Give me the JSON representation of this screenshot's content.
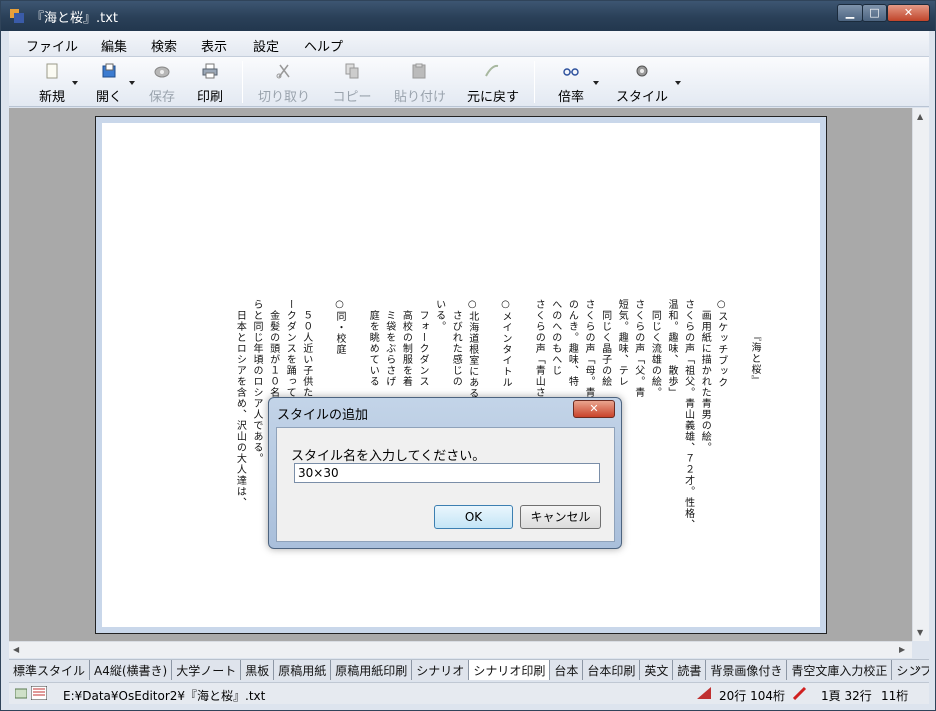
{
  "window": {
    "title": "『海と桜』.txt",
    "min": "▁",
    "max": "□",
    "close": "✕"
  },
  "menu": [
    "ファイル",
    "編集",
    "検索",
    "表示",
    "設定",
    "ヘルプ"
  ],
  "toolbar": {
    "new": "新規",
    "open": "開く",
    "save": "保存",
    "print": "印刷",
    "cut": "切り取り",
    "copy": "コピー",
    "paste": "貼り付け",
    "undo": "元に戻す",
    "zoom": "倍率",
    "style": "スタイル"
  },
  "document": {
    "columns": [
      "『海と桜』",
      "",
      "○スケッチブック",
      "　画用紙に描かれた青男の絵。",
      "さくらの声「祖父。青山義雄、７２才。性格、",
      "温和。趣味、散歩」",
      "　同じく流雄の絵。",
      "さくらの声「父。青",
      "短気。趣味、テレ",
      "　同じく晶子の絵",
      "さくらの声「母。青",
      "のんき。趣味、特",
      "へのへのもへじ",
      "さくらの声「青山さ",
      "",
      "○メインタイトル",
      "",
      "○北海道根室にある",
      "　さびれた感じの",
      "いる。",
      "　フォークダンス",
      "　高校の制服を着",
      "　ミ袋をぶらさげ",
      "　庭を眺めている",
      "",
      "○同・校庭",
      "",
      "　５０人近い子供たちが手をつなぎ、フォ",
      "ークダンスを踊っている。",
      "　金髪の頭が１０名ほど交じっている。彼",
      "らと同じ年頃のロシア人である。",
      "　日本とロシアを含め、沢山の大人達は、"
    ]
  },
  "tabs": [
    "標準スタイル",
    "A4縦(横書き)",
    "大学ノート",
    "黒板",
    "原稿用紙",
    "原稿用紙印刷",
    "シナリオ",
    "シナリオ印刷",
    "台本",
    "台本印刷",
    "英文",
    "読書",
    "背景画像付き",
    "青空文庫入力校正",
    "シンプル"
  ],
  "active_tab": "シナリオ印刷",
  "status": {
    "path": "E:¥Data¥OsEditor2¥『海と桜』.txt",
    "row_col": "20行 104桁",
    "page_line": "1頁 32行",
    "col": "11桁"
  },
  "dialog": {
    "title": "スタイルの追加",
    "close": "✕",
    "prompt": "スタイル名を入力してください。",
    "input_value": "30×30",
    "ok": "OK",
    "cancel": "キャンセル"
  }
}
